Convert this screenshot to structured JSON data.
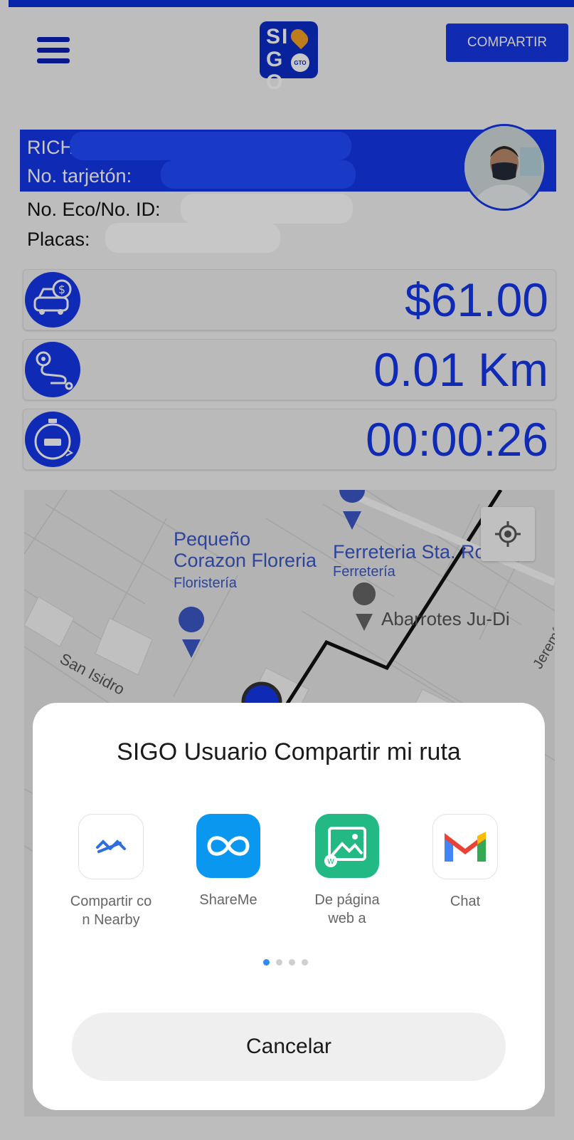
{
  "header": {
    "share_label": "COMPARTIR",
    "logo_text": "SIGO",
    "logo_sub": "GTO"
  },
  "driver": {
    "name_prefix": "RICH",
    "card_label": "No. tarjetón:",
    "eco_label": "No. Eco/No. ID:",
    "plates_label": "Placas:"
  },
  "metrics": {
    "fare": "$61.00",
    "distance": "0.01 Km",
    "time": "00:00:26"
  },
  "map": {
    "poi_florist_name": "Pequeño\nCorazon Floreria",
    "poi_florist_type": "Floristería",
    "poi_hardware_name": "Ferreteria Sta. Rosa",
    "poi_hardware_type": "Ferretería",
    "poi_grocery_name": "Abarrotes Ju-Di",
    "street_1": "San Isidro",
    "street_2": "Jeremí"
  },
  "share_sheet": {
    "title": "SIGO Usuario Compartir mi ruta",
    "apps": [
      {
        "label": "Compartir co\nn Nearby",
        "icon": "nearby-share-icon"
      },
      {
        "label": "ShareMe",
        "icon": "shareme-icon"
      },
      {
        "label": "De página\nweb a",
        "icon": "gallery-icon"
      },
      {
        "label": "Chat",
        "icon": "gmail-icon"
      }
    ],
    "page_count": 4,
    "active_page": 1,
    "cancel_label": "Cancelar"
  },
  "colors": {
    "brand_blue": "#1437e8",
    "logo_orange": "#f2a024"
  }
}
